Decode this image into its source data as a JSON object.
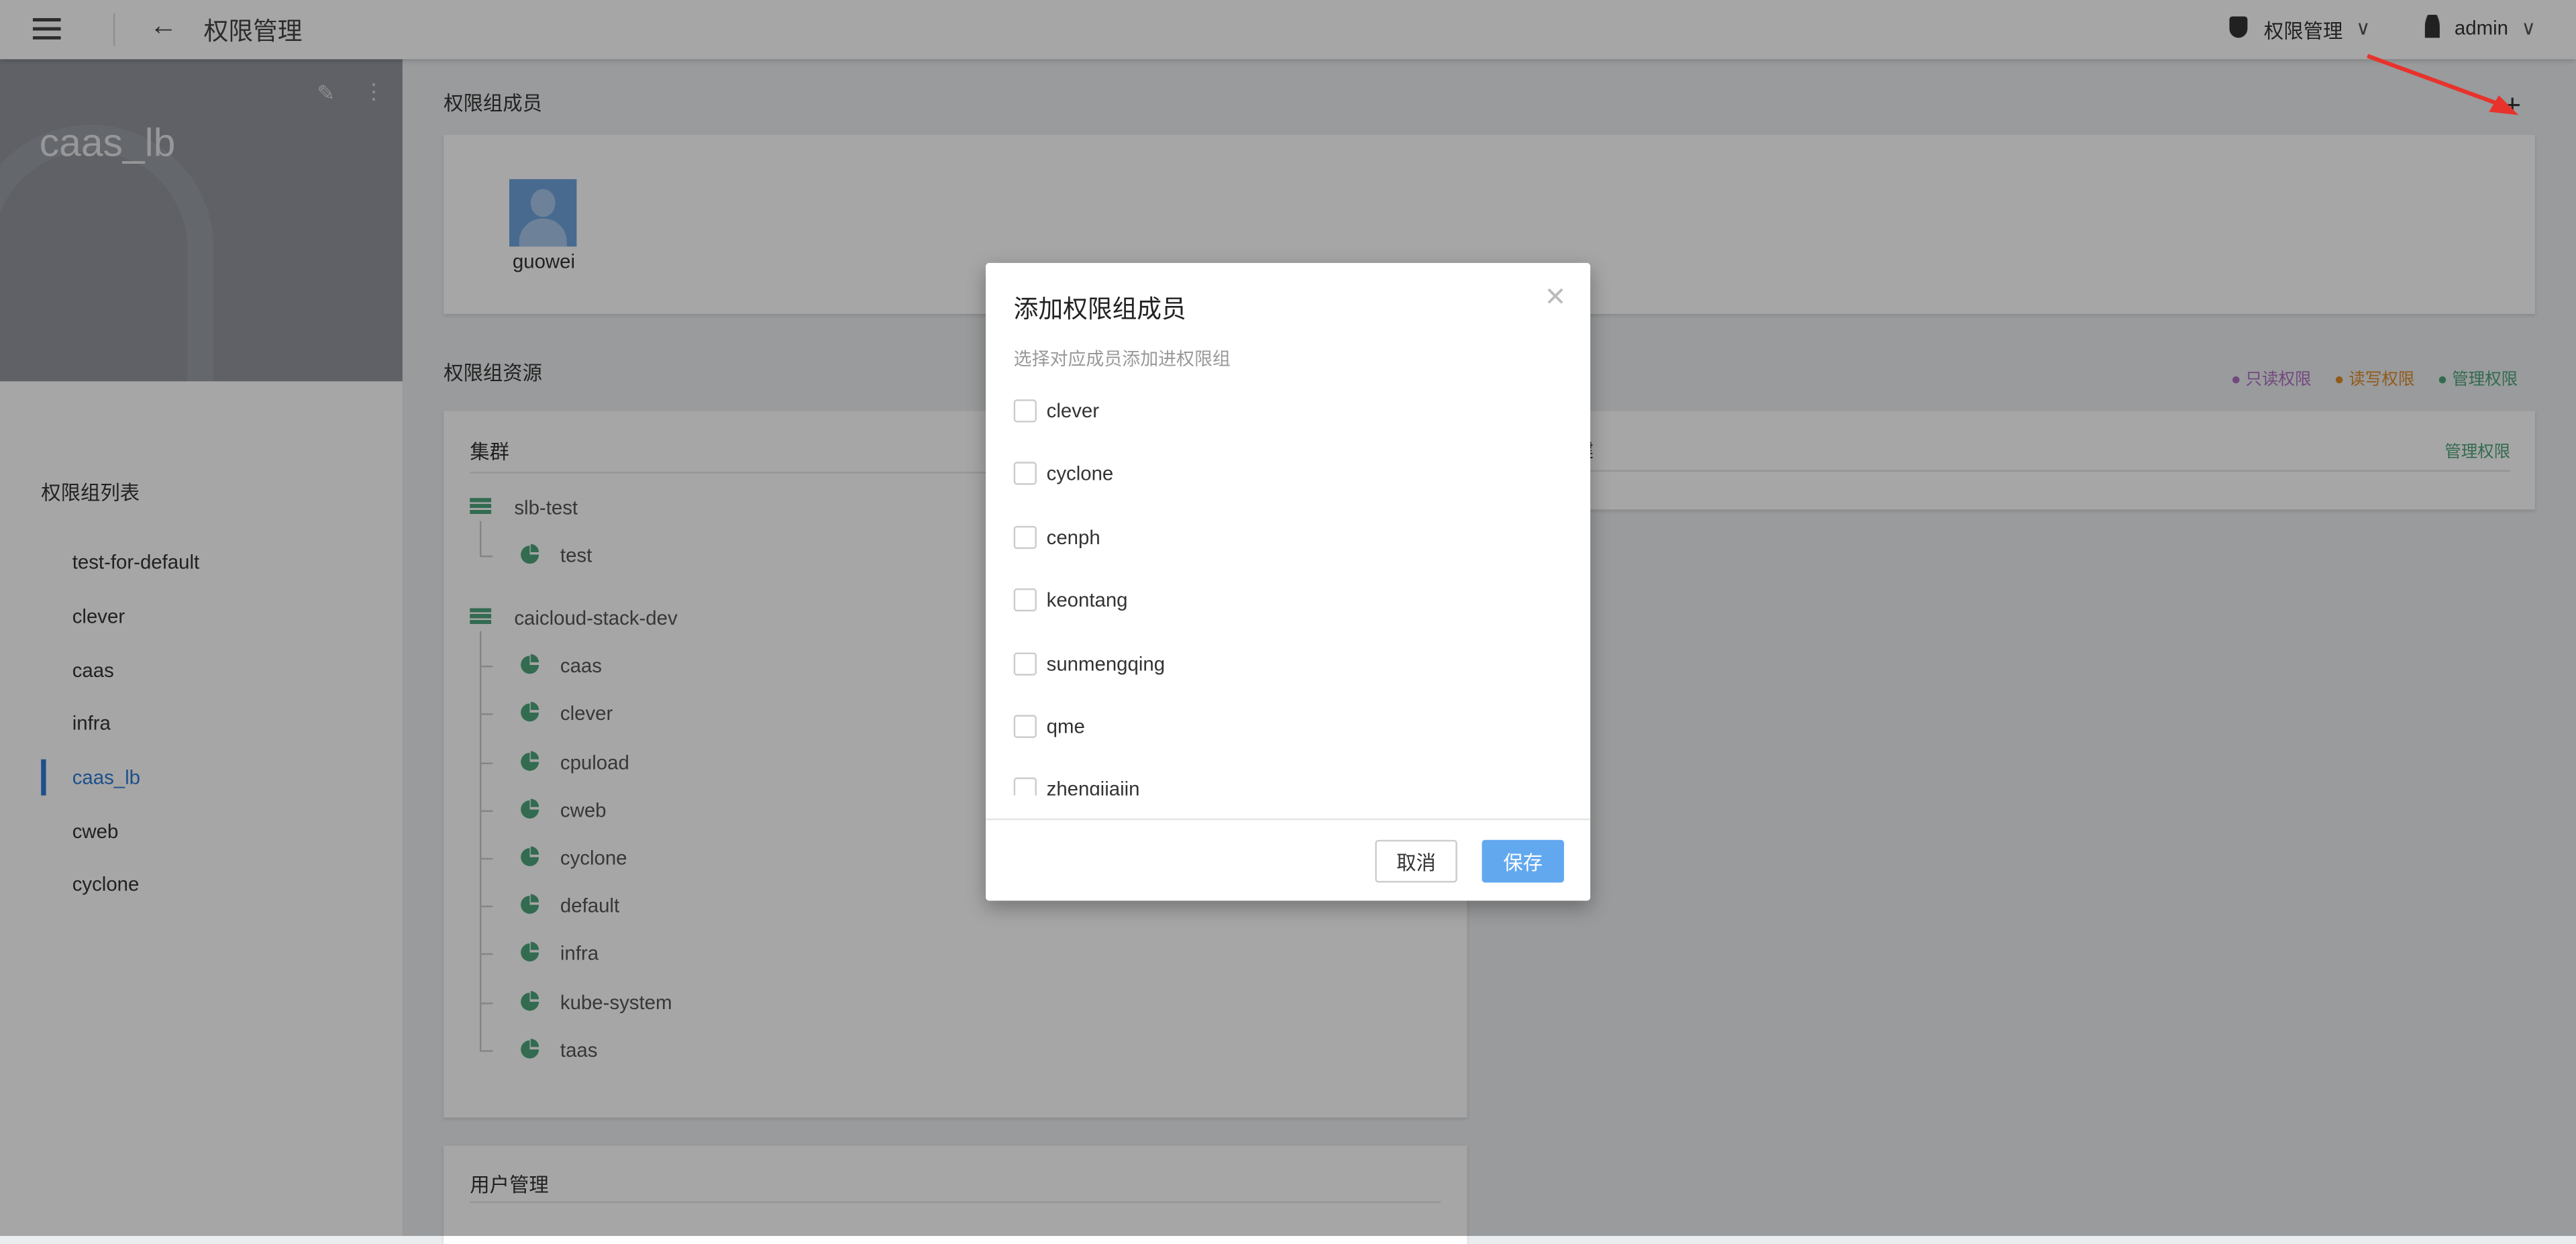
{
  "header": {
    "title": "权限管理",
    "menu_label": "权限管理",
    "user": "admin"
  },
  "sidebar": {
    "group_name": "caas_lb",
    "list_title": "权限组列表",
    "items": [
      {
        "label": "test-for-default"
      },
      {
        "label": "clever"
      },
      {
        "label": "caas"
      },
      {
        "label": "infra"
      },
      {
        "label": "caas_lb",
        "active": true
      },
      {
        "label": "cweb"
      },
      {
        "label": "cyclone"
      }
    ]
  },
  "members": {
    "title": "权限组成员",
    "list": [
      {
        "name": "guowei"
      }
    ]
  },
  "resources": {
    "title": "权限组资源",
    "legend": [
      {
        "label": "只读权限",
        "color": "#b06fc4"
      },
      {
        "label": "读写权限",
        "color": "#e08a2a"
      },
      {
        "label": "管理权限",
        "color": "#4fa57b"
      }
    ],
    "cluster_card": {
      "title": "集群",
      "clusters": [
        {
          "name": "slb-test",
          "namespaces": [
            "test"
          ]
        },
        {
          "name": "caicloud-stack-dev",
          "namespaces": [
            "caas",
            "clever",
            "cpuload",
            "cweb",
            "cyclone",
            "default",
            "infra",
            "kube-system",
            "taas"
          ]
        }
      ]
    },
    "right_card": {
      "title": "建",
      "permission": "管理权限"
    },
    "user_card": {
      "title": "用户管理"
    }
  },
  "modal": {
    "title": "添加权限组成员",
    "subtitle": "选择对应成员添加进权限组",
    "options": [
      {
        "label": "clever",
        "checked": false
      },
      {
        "label": "cyclone",
        "checked": false
      },
      {
        "label": "cenph",
        "checked": false
      },
      {
        "label": "keontang",
        "checked": false
      },
      {
        "label": "sunmengqing",
        "checked": false
      },
      {
        "label": "qme",
        "checked": false
      },
      {
        "label": "zhengjiajin",
        "checked": false
      }
    ],
    "cancel": "取消",
    "save": "保存"
  },
  "colors": {
    "accent": "#2d7bd6",
    "primary_button": "#62a8ef",
    "green": "#4fa57b",
    "arrow": "#e8322c"
  }
}
